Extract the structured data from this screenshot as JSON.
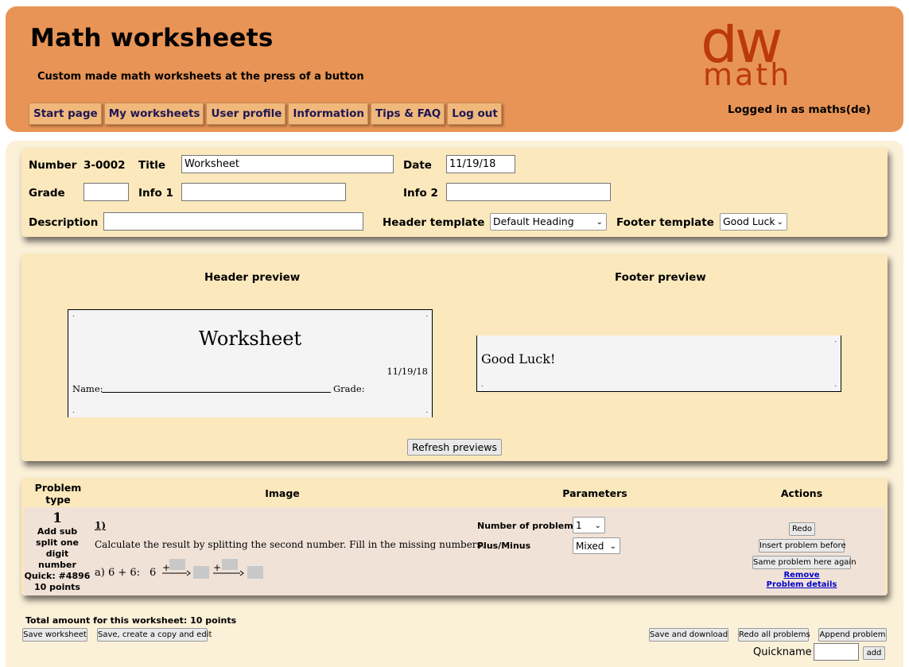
{
  "app": {
    "title": "Math worksheets",
    "subtitle": "Custom made math worksheets at the press of a button",
    "logo_top": "dw",
    "logo_bottom": "math",
    "logged_in": "Logged in as maths(de)"
  },
  "nav": [
    "Start page",
    "My worksheets",
    "User profile",
    "Information",
    "Tips & FAQ",
    "Log out"
  ],
  "form": {
    "number_label": "Number",
    "number_value": "3-0002",
    "title_label": "Title",
    "title_value": "Worksheet",
    "date_label": "Date",
    "date_value": "11/19/18",
    "grade_label": "Grade",
    "grade_value": "",
    "info1_label": "Info 1",
    "info1_value": "",
    "info2_label": "Info 2",
    "info2_value": "",
    "description_label": "Description",
    "description_value": "",
    "header_template_label": "Header template",
    "header_template_value": "Default Heading",
    "footer_template_label": "Footer template",
    "footer_template_value": "Good Luck"
  },
  "previews": {
    "header_title": "Header preview",
    "footer_title": "Footer preview",
    "header_heading": "Worksheet",
    "header_date": "11/19/18",
    "header_name_label": "Name:",
    "header_grade_label": "Grade:",
    "footer_text": "Good Luck!",
    "refresh_label": "Refresh previews"
  },
  "table": {
    "col_type": "Problem type",
    "col_image": "Image",
    "col_params": "Parameters",
    "col_actions": "Actions",
    "row": {
      "index": "1",
      "type_name": "Add sub split one digit number",
      "quick": "Quick: #4896",
      "points": "10 points",
      "problem_label": "1)",
      "instruction": "Calculate the result by splitting the second number. Fill in the missing numbers.",
      "example_prefix": "a) 6 + 6:",
      "example_start": "6",
      "plus_sign": "+",
      "param1_label": "Number of problems",
      "param1_value": "1",
      "param2_label": "Plus/Minus",
      "param2_value": "Mixed",
      "redo": "Redo",
      "insert_before": "Insert problem before",
      "same_again": "Same problem here again",
      "remove": "Remove",
      "details": "Problem details"
    }
  },
  "footer": {
    "total": "Total amount for this worksheet: 10 points",
    "save": "Save worksheet",
    "save_copy": "Save, create a copy and edit",
    "save_download": "Save and download",
    "redo_all": "Redo all problems",
    "append": "Append problem",
    "quickname_label": "Quickname",
    "quickname_value": "",
    "add": "add"
  }
}
